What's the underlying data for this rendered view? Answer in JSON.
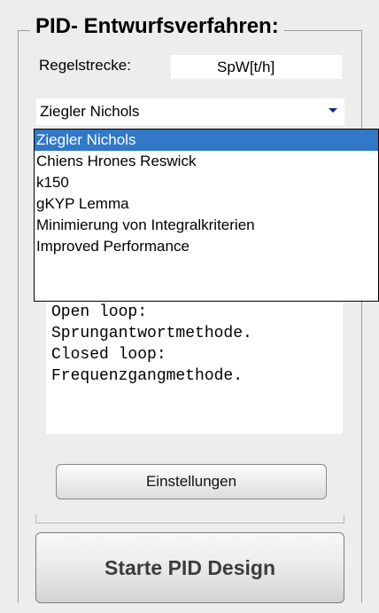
{
  "panel": {
    "title": "PID- Entwurfsverfahren:"
  },
  "regelstrecke": {
    "label": "Regelstrecke:",
    "value": "SpW[t/h]"
  },
  "method_dropdown": {
    "selected": "Ziegler Nichols",
    "arrow_icon": "chevron-down-icon",
    "options": [
      "Ziegler Nichols",
      "Chiens Hrones Reswick",
      "k150",
      "gKYP Lemma",
      "Minimierung von Integralkriterien",
      "Improved Performance"
    ],
    "highlighted_index": 0,
    "highlight_color": "#3178c7"
  },
  "description": {
    "lines": [
      "Open loop:",
      "Sprungantwortmethode.",
      "Closed loop:",
      "Frequenzgangmethode."
    ]
  },
  "buttons": {
    "settings_label": "Einstellungen",
    "start_label": "Starte PID Design"
  }
}
